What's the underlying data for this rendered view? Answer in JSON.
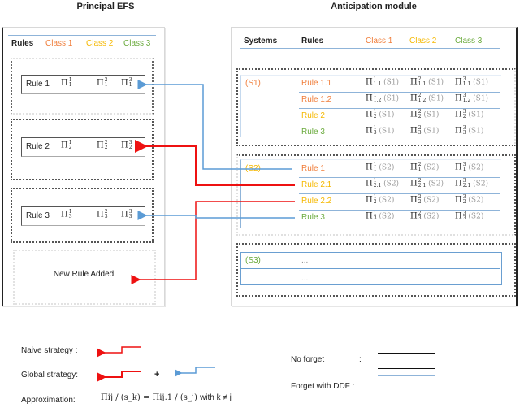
{
  "titles": {
    "left": "Principal EFS",
    "right": "Anticipation module"
  },
  "colors": {
    "class1": "#f07d3a",
    "class2": "#f5b800",
    "class3": "#6aaa3c",
    "naive_arrow": "#ee1111",
    "ddf_arrow": "#5b9bd5",
    "divider_blue": "#8fb4d9"
  },
  "left_panel": {
    "headers": [
      "Rules",
      "Class 1",
      "Class 2",
      "Class 3"
    ],
    "rules": [
      {
        "label": "Rule 1",
        "cells": [
          {
            "sym": "Π",
            "sup": "1",
            "sub": "1"
          },
          {
            "sym": "Π",
            "sup": "2",
            "sub": "1"
          },
          {
            "sym": "Π",
            "sup": "3",
            "sub": "1"
          }
        ]
      },
      {
        "label": "Rule 2",
        "cells": [
          {
            "sym": "Π",
            "sup": "1",
            "sub": "2"
          },
          {
            "sym": "Π",
            "sup": "2",
            "sub": "2"
          },
          {
            "sym": "Π",
            "sup": "3",
            "sub": "2"
          }
        ]
      },
      {
        "label": "Rule 3",
        "cells": [
          {
            "sym": "Π",
            "sup": "1",
            "sub": "3"
          },
          {
            "sym": "Π",
            "sup": "2",
            "sub": "3"
          },
          {
            "sym": "Π",
            "sup": "3",
            "sub": "3"
          }
        ]
      }
    ],
    "new_rule_label": "New Rule Added"
  },
  "right_panel": {
    "headers": [
      "Systems",
      "Rules",
      "Class 1",
      "Class 2",
      "Class 3"
    ],
    "systems": [
      {
        "name": "(S1)",
        "rows": [
          {
            "rule": "Rule 1.1",
            "cells": [
              {
                "sym": "Π",
                "sup": "1",
                "sub": "1.1",
                "sys": "(S1)"
              },
              {
                "sym": "Π",
                "sup": "2",
                "sub": "1.1",
                "sys": "(S1)"
              },
              {
                "sym": "Π",
                "sup": "3",
                "sub": "1.1",
                "sys": "(S1)"
              }
            ]
          },
          {
            "rule": "Rule 1.2",
            "cells": [
              {
                "sym": "Π",
                "sup": "1",
                "sub": "1.2",
                "sys": "(S1)"
              },
              {
                "sym": "Π",
                "sup": "2",
                "sub": "1.2",
                "sys": "(S1)"
              },
              {
                "sym": "Π",
                "sup": "3",
                "sub": "1.2",
                "sys": "(S1)"
              }
            ]
          },
          {
            "rule": "Rule 2",
            "cells": [
              {
                "sym": "Π",
                "sup": "1",
                "sub": "2",
                "sys": "(S1)"
              },
              {
                "sym": "Π",
                "sup": "2",
                "sub": "2",
                "sys": "(S1)"
              },
              {
                "sym": "Π",
                "sup": "3",
                "sub": "2",
                "sys": "(S1)"
              }
            ]
          },
          {
            "rule": "Rule 3",
            "cells": [
              {
                "sym": "Π",
                "sup": "1",
                "sub": "3",
                "sys": "(S1)"
              },
              {
                "sym": "Π",
                "sup": "2",
                "sub": "3",
                "sys": "(S1)"
              },
              {
                "sym": "Π",
                "sup": "3",
                "sub": "3",
                "sys": "(S1)"
              }
            ]
          }
        ]
      },
      {
        "name": "(S2)",
        "rows": [
          {
            "rule": "Rule 1",
            "cells": [
              {
                "sym": "Π",
                "sup": "1",
                "sub": "1",
                "sys": "(S2)"
              },
              {
                "sym": "Π",
                "sup": "2",
                "sub": "1",
                "sys": "(S2)"
              },
              {
                "sym": "Π",
                "sup": "3",
                "sub": "1",
                "sys": "(S2)"
              }
            ]
          },
          {
            "rule": "Rule 2.1",
            "cells": [
              {
                "sym": "Π",
                "sup": "1",
                "sub": "2.1",
                "sys": "(S2)"
              },
              {
                "sym": "Π",
                "sup": "2",
                "sub": "2.1",
                "sys": "(S2)"
              },
              {
                "sym": "Π",
                "sup": "3",
                "sub": "2.1",
                "sys": "(S2)"
              }
            ]
          },
          {
            "rule": "Rule 2.2",
            "cells": [
              {
                "sym": "Π",
                "sup": "1",
                "sub": "2",
                "sys": "(S2)"
              },
              {
                "sym": "Π",
                "sup": "2",
                "sub": "2",
                "sys": "(S2)"
              },
              {
                "sym": "Π",
                "sup": "3",
                "sub": "2",
                "sys": "(S2)"
              }
            ]
          },
          {
            "rule": "Rule 3",
            "cells": [
              {
                "sym": "Π",
                "sup": "1",
                "sub": "3",
                "sys": "(S2)"
              },
              {
                "sym": "Π",
                "sup": "2",
                "sub": "3",
                "sys": "(S2)"
              },
              {
                "sym": "Π",
                "sup": "3",
                "sub": "3",
                "sys": "(S2)"
              }
            ]
          }
        ]
      },
      {
        "name": "(S3)",
        "rows": [
          {
            "rule": "..."
          },
          {
            "rule": "..."
          }
        ]
      }
    ]
  },
  "legend": {
    "naive_label": "Naive strategy :",
    "global_label": "Global strategy:",
    "plus": "+",
    "approx_label": "Approximation:",
    "approx_formula": {
      "lhs_sym": "Π",
      "lhs_sup": "i",
      "lhs_sub": "j / (s_k)",
      "eq": "=",
      "rhs_sym": "Π",
      "rhs_sup": "i",
      "rhs_sub": "j.1 / (s_j)",
      "condition": "with k ≠ j"
    },
    "no_forget_label": "No forget",
    "no_forget_colon": ":",
    "ddf_label": "Forget with DDF :"
  }
}
